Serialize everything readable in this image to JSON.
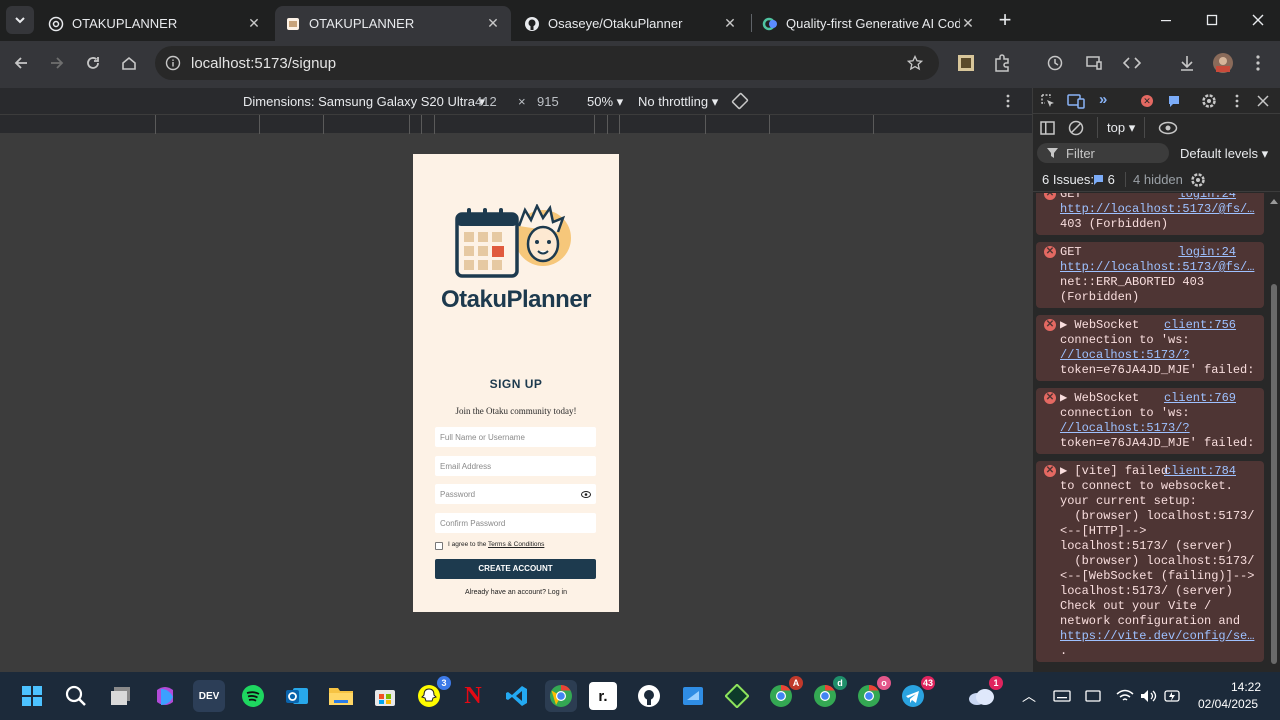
{
  "tabs": [
    {
      "title": "OTAKUPLANNER",
      "favicon": "globe-icon"
    },
    {
      "title": "OTAKUPLANNER",
      "favicon": "page-icon"
    },
    {
      "title": "Osaseye/OtakuPlanner",
      "favicon": "github-icon"
    },
    {
      "title": "Quality-first Generative AI Codi",
      "favicon": "qodo-icon"
    }
  ],
  "address_bar": {
    "url": "localhost:5173/signup"
  },
  "device_toolbar": {
    "device": "Dimensions: Samsung Galaxy S20 Ultra",
    "width": "412",
    "times": "×",
    "height": "915",
    "zoom": "50%",
    "throttling": "No throttling"
  },
  "signup_page": {
    "brand": "OtakuPlanner",
    "heading": "SIGN UP",
    "subheading": "Join the Otaku community today!",
    "fields": {
      "name_placeholder": "Full Name or Username",
      "email_placeholder": "Email Address",
      "password_placeholder": "Password",
      "confirm_placeholder": "Confirm Password"
    },
    "agree_prefix": "I agree to the",
    "terms_link": "Terms & Conditions",
    "submit": "CREATE ACCOUNT",
    "login_prompt": "Already have an account? Log in"
  },
  "devtools": {
    "context": "top",
    "filter_placeholder": "Filter",
    "levels": "Default levels",
    "issues_label": "6 Issues:",
    "issues_count": "6",
    "hidden": "4 hidden",
    "messages": [
      {
        "source": "login:24",
        "lines": [
          "GET",
          "http://localhost:5173/@fs/…",
          "403 (Forbidden)"
        ]
      },
      {
        "source": "login:24",
        "lines": [
          "GET",
          "http://localhost:5173/@fs/…",
          "net::ERR_ABORTED 403",
          "(Forbidden)"
        ]
      },
      {
        "source": "client:756",
        "lines": [
          "▶ WebSocket",
          "connection to 'ws:",
          "//localhost:5173/?",
          "token=e76JA4JD_MJE' failed:"
        ]
      },
      {
        "source": "client:769",
        "lines": [
          "▶ WebSocket",
          "connection to 'ws:",
          "//localhost:5173/?",
          "token=e76JA4JD_MJE' failed:"
        ]
      },
      {
        "source": "client:784",
        "lines": [
          "▶ [vite] failed",
          "to connect to websocket.",
          "your current setup:",
          "  (browser) localhost:5173/",
          "<--[HTTP]-->",
          "localhost:5173/ (server)",
          "  (browser) localhost:5173/",
          "<--[WebSocket (failing)]-->",
          "localhost:5173/ (server)",
          "Check out your Vite /",
          "network configuration and",
          "https://vite.dev/config/se…",
          "."
        ]
      }
    ],
    "prompt": "›"
  },
  "taskbar": {
    "time": "14:22",
    "date": "02/04/2025",
    "badges": {
      "snapchat": "3",
      "chrome_a": "A",
      "chrome_d": "d",
      "chrome_o": "o",
      "telegram": "43",
      "weather": "1"
    },
    "dev_label": "DEV"
  },
  "colors": {
    "accent": "#1d3a4e",
    "page_bg": "#fdf2e6",
    "error_bg": "#4e3534"
  }
}
